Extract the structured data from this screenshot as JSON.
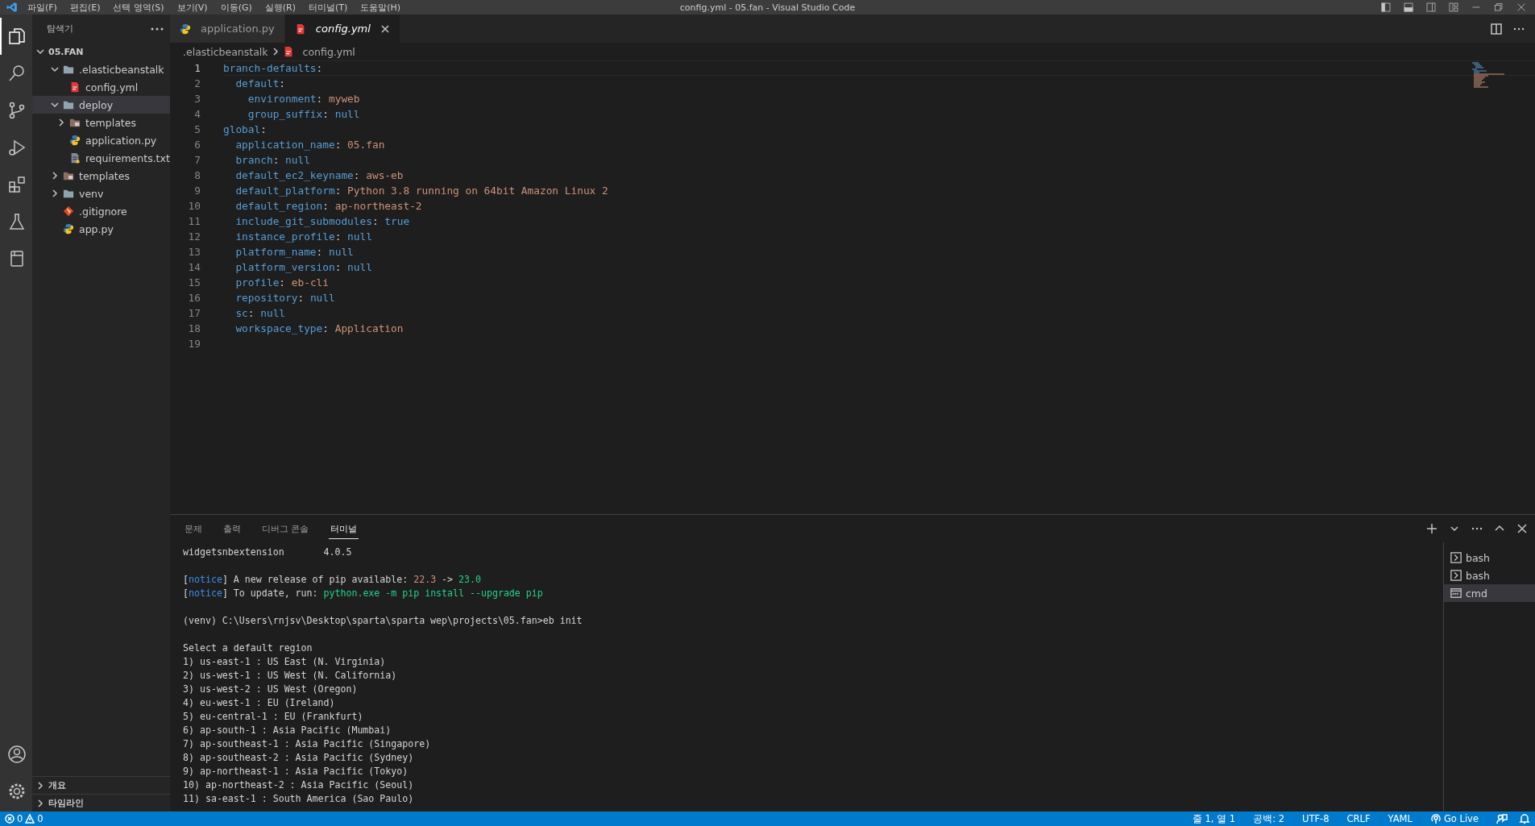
{
  "title_bar": {
    "menu": [
      "파일(F)",
      "편집(E)",
      "선택 영역(S)",
      "보기(V)",
      "이동(G)",
      "실행(R)",
      "터미널(T)",
      "도움말(H)"
    ],
    "title": "config.yml - 05.fan - Visual Studio Code"
  },
  "activity_bar": {
    "items": [
      {
        "kind": "explorer",
        "selected": true
      },
      {
        "kind": "search",
        "selected": false
      },
      {
        "kind": "source-control",
        "selected": false
      },
      {
        "kind": "run-debug",
        "selected": false
      },
      {
        "kind": "extensions",
        "selected": false
      },
      {
        "kind": "testing",
        "selected": false
      },
      {
        "kind": "notebook",
        "selected": false
      }
    ],
    "bottom": [
      {
        "kind": "account"
      },
      {
        "kind": "settings"
      }
    ]
  },
  "sidebar": {
    "title": "탐색기",
    "root": {
      "label": "05.FAN",
      "expanded": true
    },
    "items": [
      {
        "label": ".elasticbeanstalk",
        "kind": "folder",
        "expanded": true,
        "selected": false,
        "children": [
          {
            "label": "config.yml",
            "kind": "yaml",
            "selected": false
          }
        ]
      },
      {
        "label": "deploy",
        "kind": "folder",
        "expanded": true,
        "selected": true,
        "children": [
          {
            "label": "templates",
            "kind": "template-folder",
            "expanded": false,
            "selected": false
          },
          {
            "label": "application.py",
            "kind": "python",
            "selected": false
          },
          {
            "label": "requirements.txt",
            "kind": "text",
            "selected": false
          }
        ]
      },
      {
        "label": "templates",
        "kind": "template-folder",
        "expanded": false,
        "selected": false
      },
      {
        "label": "venv",
        "kind": "folder",
        "expanded": false,
        "selected": false
      },
      {
        "label": ".gitignore",
        "kind": "git",
        "selected": false
      },
      {
        "label": "app.py",
        "kind": "python",
        "selected": false
      }
    ],
    "sections": [
      {
        "label": "개요",
        "expanded": false
      },
      {
        "label": "타임라인",
        "expanded": false
      }
    ]
  },
  "editor": {
    "tabs": [
      {
        "label": "application.py",
        "kind": "python",
        "selected": false,
        "preview": false
      },
      {
        "label": "config.yml",
        "kind": "yaml",
        "selected": true,
        "preview": true
      }
    ],
    "breadcrumb": [
      {
        "label": ".elasticbeanstalk",
        "kind": "folder-path"
      },
      {
        "label": "config.yml",
        "kind": "yaml"
      }
    ],
    "lines": [
      {
        "number": "1",
        "selected": true,
        "segments": [
          {
            "text": "branch-defaults",
            "kind": "key"
          },
          {
            "text": ":",
            "kind": "plain"
          }
        ]
      },
      {
        "number": "2",
        "selected": false,
        "segments": [
          {
            "text": "  default",
            "kind": "key"
          },
          {
            "text": ":",
            "kind": "plain"
          }
        ]
      },
      {
        "number": "3",
        "selected": false,
        "segments": [
          {
            "text": "    environment",
            "kind": "key"
          },
          {
            "text": ": ",
            "kind": "plain"
          },
          {
            "text": "myweb",
            "kind": "string"
          }
        ]
      },
      {
        "number": "4",
        "selected": false,
        "segments": [
          {
            "text": "    group_suffix",
            "kind": "key"
          },
          {
            "text": ": ",
            "kind": "plain"
          },
          {
            "text": "null",
            "kind": "literal"
          }
        ]
      },
      {
        "number": "5",
        "selected": false,
        "segments": [
          {
            "text": "global",
            "kind": "key"
          },
          {
            "text": ":",
            "kind": "plain"
          }
        ]
      },
      {
        "number": "6",
        "selected": false,
        "segments": [
          {
            "text": "  application_name",
            "kind": "key"
          },
          {
            "text": ": ",
            "kind": "plain"
          },
          {
            "text": "05.fan",
            "kind": "string"
          }
        ]
      },
      {
        "number": "7",
        "selected": false,
        "segments": [
          {
            "text": "  branch",
            "kind": "key"
          },
          {
            "text": ": ",
            "kind": "plain"
          },
          {
            "text": "null",
            "kind": "literal"
          }
        ]
      },
      {
        "number": "8",
        "selected": false,
        "segments": [
          {
            "text": "  default_ec2_keyname",
            "kind": "key"
          },
          {
            "text": ": ",
            "kind": "plain"
          },
          {
            "text": "aws-eb",
            "kind": "string"
          }
        ]
      },
      {
        "number": "9",
        "selected": false,
        "segments": [
          {
            "text": "  default_platform",
            "kind": "key"
          },
          {
            "text": ": ",
            "kind": "plain"
          },
          {
            "text": "Python 3.8 running on 64bit Amazon Linux 2",
            "kind": "string"
          }
        ]
      },
      {
        "number": "10",
        "selected": false,
        "segments": [
          {
            "text": "  default_region",
            "kind": "key"
          },
          {
            "text": ": ",
            "kind": "plain"
          },
          {
            "text": "ap-northeast-2",
            "kind": "string"
          }
        ]
      },
      {
        "number": "11",
        "selected": false,
        "segments": [
          {
            "text": "  include_git_submodules",
            "kind": "key"
          },
          {
            "text": ": ",
            "kind": "plain"
          },
          {
            "text": "true",
            "kind": "literal"
          }
        ]
      },
      {
        "number": "12",
        "selected": false,
        "segments": [
          {
            "text": "  instance_profile",
            "kind": "key"
          },
          {
            "text": ": ",
            "kind": "plain"
          },
          {
            "text": "null",
            "kind": "literal"
          }
        ]
      },
      {
        "number": "13",
        "selected": false,
        "segments": [
          {
            "text": "  platform_name",
            "kind": "key"
          },
          {
            "text": ": ",
            "kind": "plain"
          },
          {
            "text": "null",
            "kind": "literal"
          }
        ]
      },
      {
        "number": "14",
        "selected": false,
        "segments": [
          {
            "text": "  platform_version",
            "kind": "key"
          },
          {
            "text": ": ",
            "kind": "plain"
          },
          {
            "text": "null",
            "kind": "literal"
          }
        ]
      },
      {
        "number": "15",
        "selected": false,
        "segments": [
          {
            "text": "  profile",
            "kind": "key"
          },
          {
            "text": ": ",
            "kind": "plain"
          },
          {
            "text": "eb-cli",
            "kind": "string"
          }
        ]
      },
      {
        "number": "16",
        "selected": false,
        "segments": [
          {
            "text": "  repository",
            "kind": "key"
          },
          {
            "text": ": ",
            "kind": "plain"
          },
          {
            "text": "null",
            "kind": "literal"
          }
        ]
      },
      {
        "number": "17",
        "selected": false,
        "segments": [
          {
            "text": "  sc",
            "kind": "key"
          },
          {
            "text": ": ",
            "kind": "plain"
          },
          {
            "text": "null",
            "kind": "literal"
          }
        ]
      },
      {
        "number": "18",
        "selected": false,
        "segments": [
          {
            "text": "  workspace_type",
            "kind": "key"
          },
          {
            "text": ": ",
            "kind": "plain"
          },
          {
            "text": "Application",
            "kind": "string"
          }
        ]
      },
      {
        "number": "19",
        "selected": false
      }
    ]
  },
  "panel": {
    "tabs": [
      {
        "label": "문제",
        "selected": false
      },
      {
        "label": "출력",
        "selected": false
      },
      {
        "label": "디버그 콘솔",
        "selected": false
      },
      {
        "label": "터미널",
        "selected": true
      }
    ],
    "terminal_lines": [
      {
        "kind": "text",
        "segments": [
          {
            "text": "widgetsnbextension       4.0.5",
            "kind": "plain"
          }
        ]
      },
      {
        "kind": "blank"
      },
      {
        "kind": "text",
        "segments": [
          {
            "text": "[",
            "kind": "plain"
          },
          {
            "text": "notice",
            "kind": "info"
          },
          {
            "text": "] A new release of pip available: ",
            "kind": "plain"
          },
          {
            "text": "22.3",
            "kind": "old"
          },
          {
            "text": " -> ",
            "kind": "plain"
          },
          {
            "text": "23.0",
            "kind": "new"
          }
        ]
      },
      {
        "kind": "text",
        "segments": [
          {
            "text": "[",
            "kind": "plain"
          },
          {
            "text": "notice",
            "kind": "info"
          },
          {
            "text": "] To update, run: ",
            "kind": "plain"
          },
          {
            "text": "python.exe -m pip install --upgrade pip",
            "kind": "new"
          }
        ]
      },
      {
        "kind": "blank"
      },
      {
        "kind": "text",
        "segments": [
          {
            "text": "(venv) C:\\Users\\rnjsv\\Desktop\\sparta\\sparta wep\\projects\\05.fan>eb init",
            "kind": "plain"
          }
        ]
      },
      {
        "kind": "blank"
      },
      {
        "kind": "text",
        "segments": [
          {
            "text": "Select a default region",
            "kind": "plain"
          }
        ]
      },
      {
        "kind": "text",
        "segments": [
          {
            "text": "1) us-east-1 : US East (N. Virginia)",
            "kind": "plain"
          }
        ]
      },
      {
        "kind": "text",
        "segments": [
          {
            "text": "2) us-west-1 : US West (N. California)",
            "kind": "plain"
          }
        ]
      },
      {
        "kind": "text",
        "segments": [
          {
            "text": "3) us-west-2 : US West (Oregon)",
            "kind": "plain"
          }
        ]
      },
      {
        "kind": "text",
        "segments": [
          {
            "text": "4) eu-west-1 : EU (Ireland)",
            "kind": "plain"
          }
        ]
      },
      {
        "kind": "text",
        "segments": [
          {
            "text": "5) eu-central-1 : EU (Frankfurt)",
            "kind": "plain"
          }
        ]
      },
      {
        "kind": "text",
        "segments": [
          {
            "text": "6) ap-south-1 : Asia Pacific (Mumbai)",
            "kind": "plain"
          }
        ]
      },
      {
        "kind": "text",
        "segments": [
          {
            "text": "7) ap-southeast-1 : Asia Pacific (Singapore)",
            "kind": "plain"
          }
        ]
      },
      {
        "kind": "text",
        "segments": [
          {
            "text": "8) ap-southeast-2 : Asia Pacific (Sydney)",
            "kind": "plain"
          }
        ]
      },
      {
        "kind": "text",
        "segments": [
          {
            "text": "9) ap-northeast-1 : Asia Pacific (Tokyo)",
            "kind": "plain"
          }
        ]
      },
      {
        "kind": "text",
        "segments": [
          {
            "text": "10) ap-northeast-2 : Asia Pacific (Seoul)",
            "kind": "plain"
          }
        ]
      },
      {
        "kind": "text",
        "segments": [
          {
            "text": "11) sa-east-1 : South America (Sao Paulo)",
            "kind": "plain"
          }
        ]
      }
    ],
    "terminals": [
      {
        "label": "bash",
        "kind": "shell",
        "selected": false
      },
      {
        "label": "bash",
        "kind": "shell",
        "selected": false
      },
      {
        "label": "cmd",
        "kind": "cmd",
        "selected": true
      }
    ]
  },
  "status_bar": {
    "errors": "0",
    "warnings": "0",
    "items": [
      {
        "label": "줄 1, 열 1",
        "kind": "text"
      },
      {
        "label": "공백: 2",
        "kind": "text"
      },
      {
        "label": "UTF-8",
        "kind": "text"
      },
      {
        "label": "CRLF",
        "kind": "text"
      },
      {
        "label": "YAML",
        "kind": "text"
      },
      {
        "label": "Go Live",
        "kind": "live"
      }
    ]
  }
}
